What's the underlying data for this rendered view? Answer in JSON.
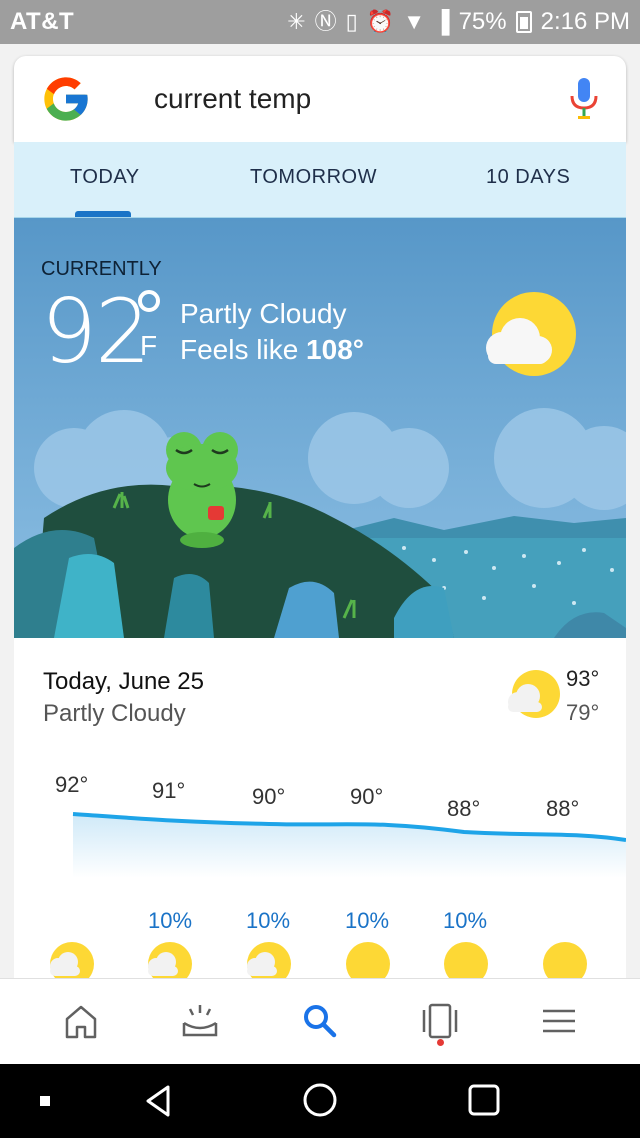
{
  "status_bar": {
    "carrier": "AT&T",
    "battery": "75%",
    "time": "2:16 PM",
    "icons": [
      "bluetooth-icon",
      "nfc-icon",
      "vibrate-icon",
      "alarm-icon",
      "wifi-icon",
      "signal-icon",
      "battery-icon"
    ]
  },
  "search": {
    "query": "current temp",
    "logo": "google-g-icon",
    "mic": "microphone-icon"
  },
  "tabs": [
    {
      "label": "TODAY",
      "selected": true
    },
    {
      "label": "TOMORROW",
      "selected": false
    },
    {
      "label": "10 DAYS",
      "selected": false
    }
  ],
  "current": {
    "heading": "CURRENTLY",
    "temp": "92",
    "unit": "F",
    "condition": "Partly Cloudy",
    "feels_prefix": "Feels like ",
    "feels_value": "108°",
    "icon": "partly-cloudy-icon"
  },
  "today": {
    "date": "Today, June 25",
    "condition": "Partly Cloudy",
    "high": "93°",
    "low": "79°",
    "icon": "partly-cloudy-icon"
  },
  "hourly": {
    "temps": [
      "92°",
      "91°",
      "90°",
      "90°",
      "88°",
      "88°"
    ],
    "precip": [
      "",
      "10%",
      "10%",
      "10%",
      "10%",
      ""
    ],
    "icons": [
      "partly-cloudy-icon",
      "partly-cloudy-icon",
      "partly-cloudy-icon",
      "sunny-icon",
      "sunny-icon",
      "sunny-icon"
    ]
  },
  "bottom_nav": [
    {
      "name": "home-icon"
    },
    {
      "name": "updates-icon"
    },
    {
      "name": "search-icon",
      "active": true
    },
    {
      "name": "recent-icon",
      "badge": true
    },
    {
      "name": "menu-icon"
    }
  ],
  "system_nav": [
    "back-icon",
    "home-button-icon",
    "overview-icon"
  ],
  "colors": {
    "status_bar": "#9e9e9e",
    "tab_bg": "#d9f0fa",
    "hero_bg": "#5a9ccc",
    "accent_blue": "#1a73c7",
    "sun": "#fdd835"
  }
}
